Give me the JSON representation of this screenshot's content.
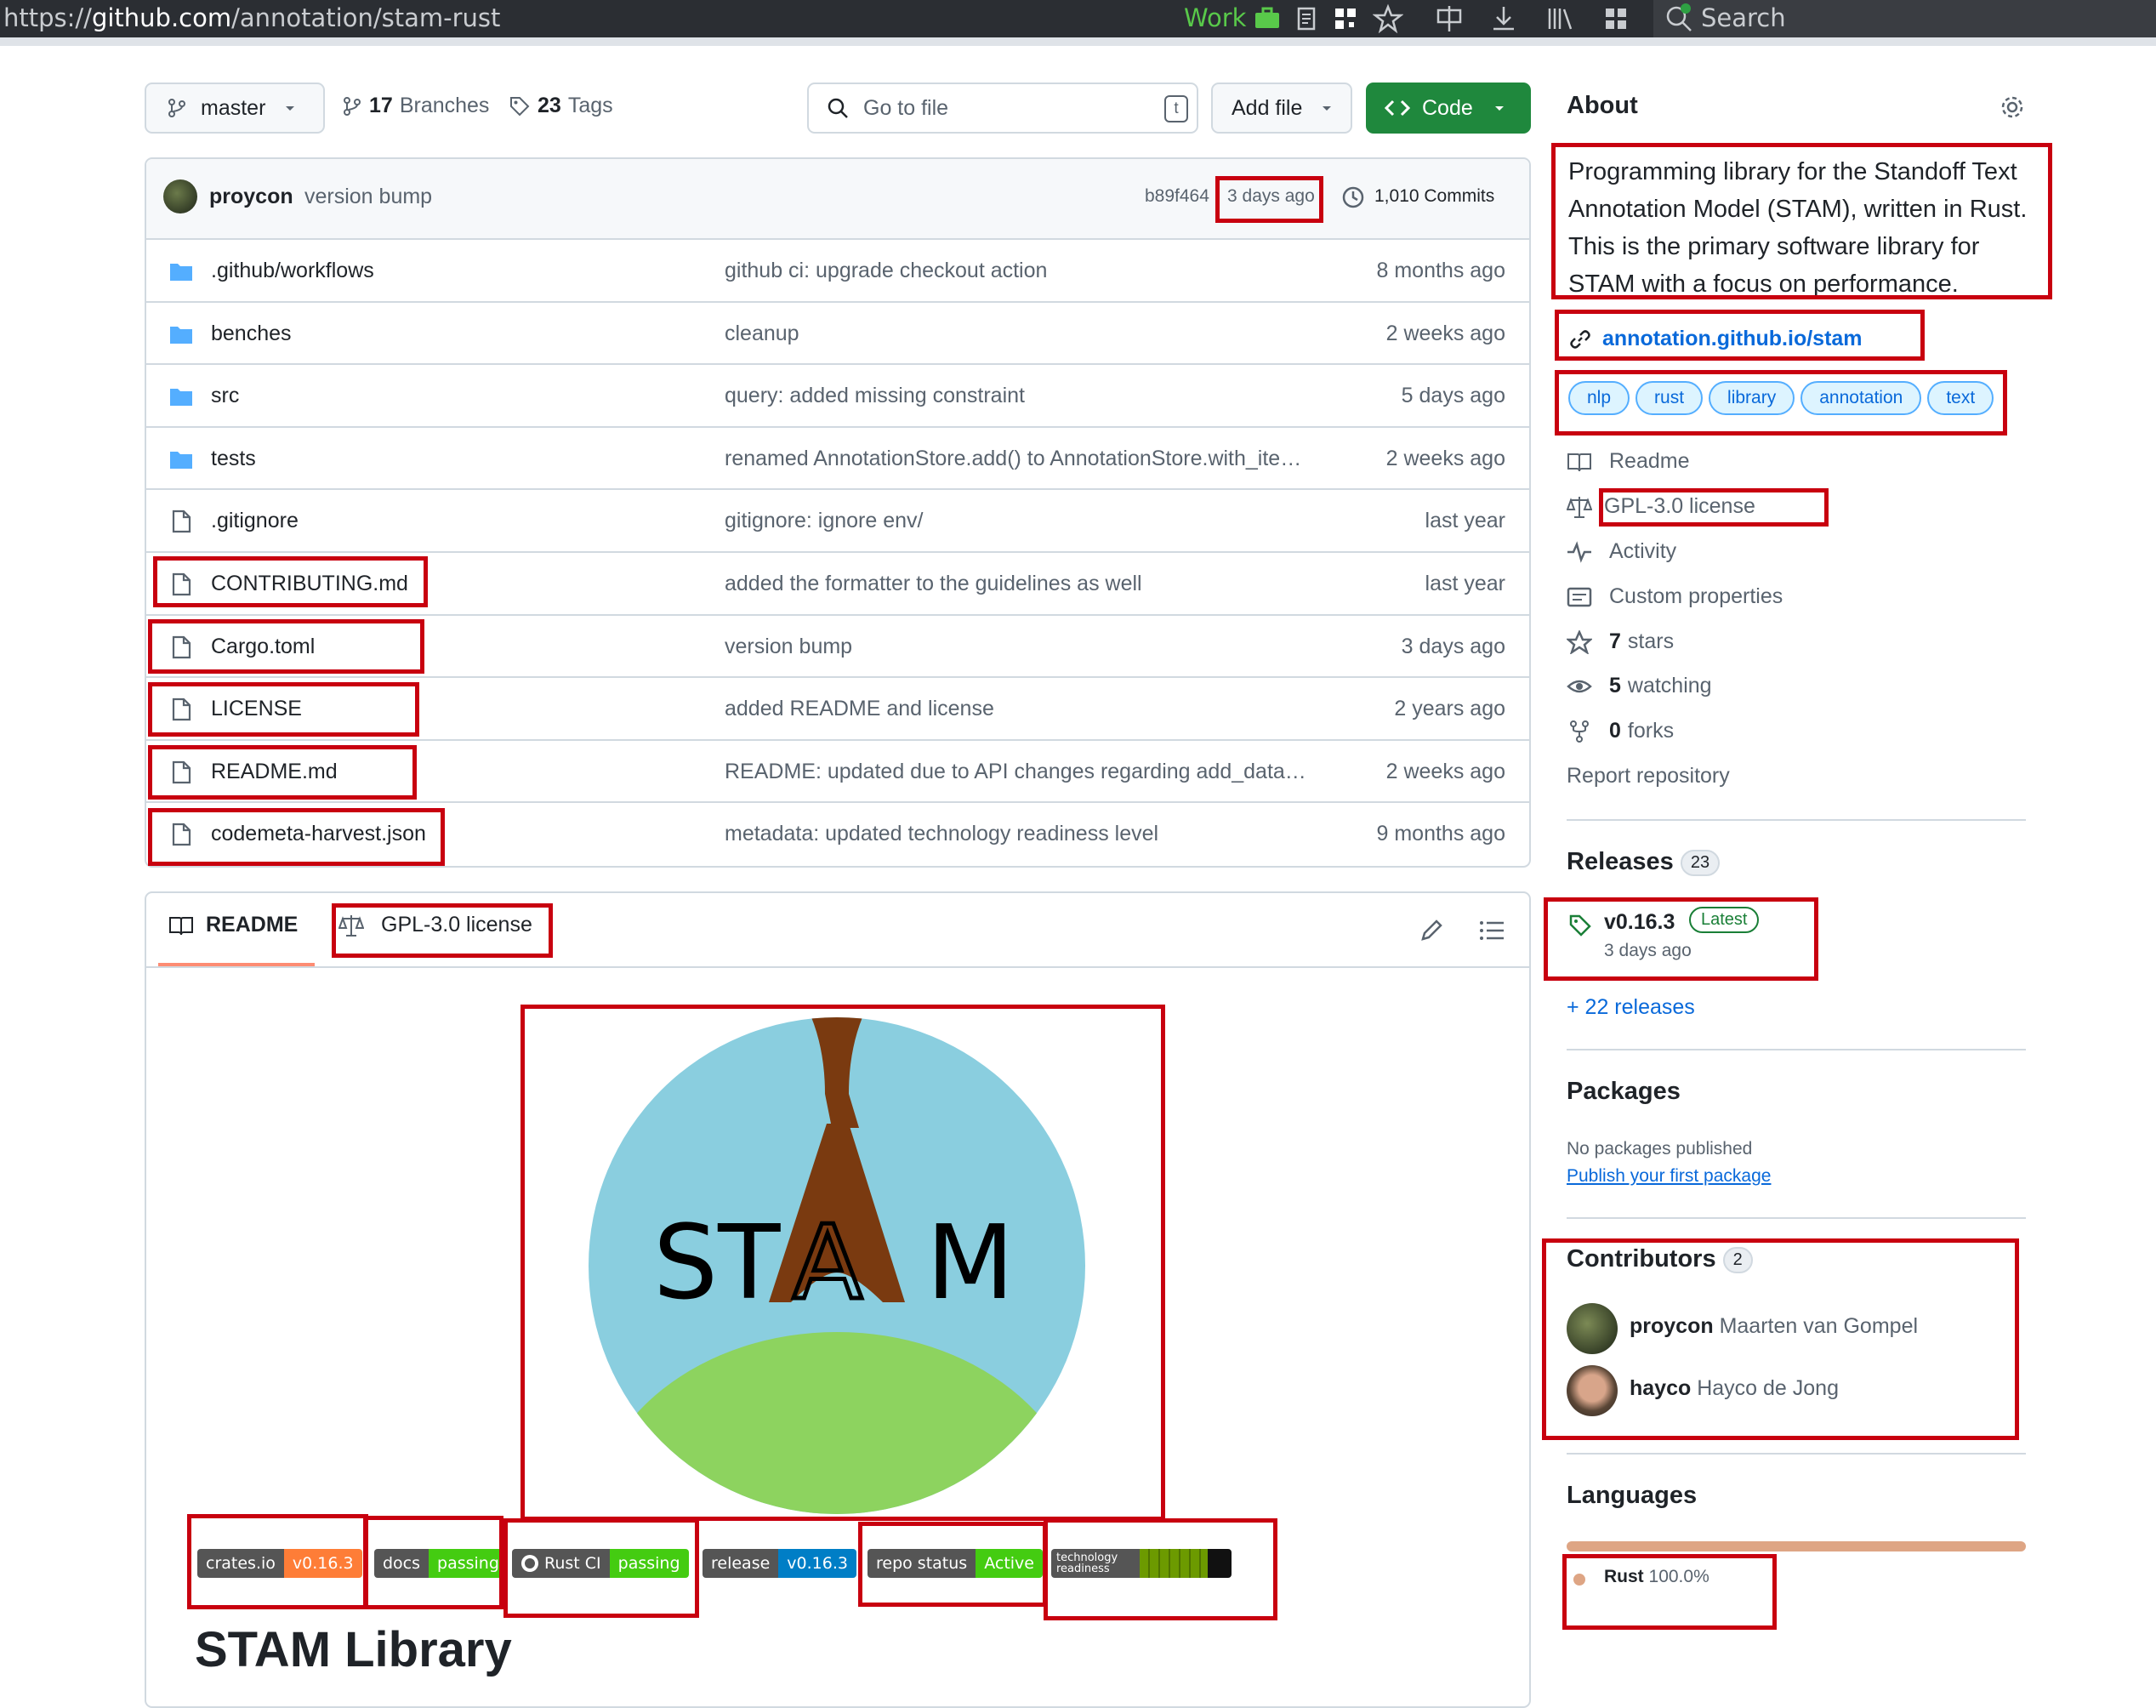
{
  "browser": {
    "url_prefix": "https://",
    "url_domain": "github.com",
    "url_path": "/annotation/stam-rust",
    "container_label": "Work",
    "search_placeholder": "Search"
  },
  "repo_toolbar": {
    "branch": "master",
    "branches_count": "17",
    "branches_label": "Branches",
    "tags_count": "23",
    "tags_label": "Tags",
    "goto_file_placeholder": "Go to file",
    "goto_file_shortcut": "t",
    "add_file_label": "Add file",
    "code_label": "Code"
  },
  "latest_commit": {
    "author": "proycon",
    "message": "version bump",
    "hash": "b89f464",
    "age": "3 days ago",
    "commits_label": "1,010 Commits"
  },
  "files": [
    {
      "type": "folder",
      "name": ".github/workflows",
      "message": "github ci: upgrade checkout action",
      "age": "8 months ago"
    },
    {
      "type": "folder",
      "name": "benches",
      "message": "cleanup",
      "age": "2 weeks ago"
    },
    {
      "type": "folder",
      "name": "src",
      "message": "query: added missing constraint",
      "age": "5 days ago"
    },
    {
      "type": "folder",
      "name": "tests",
      "message": "renamed AnnotationStore.add() to AnnotationStore.with_ite…",
      "age": "2 weeks ago"
    },
    {
      "type": "file",
      "name": ".gitignore",
      "message": "gitignore: ignore env/",
      "age": "last year"
    },
    {
      "type": "file",
      "name": "CONTRIBUTING.md",
      "message": "added the formatter to the guidelines as well",
      "age": "last year"
    },
    {
      "type": "file",
      "name": "Cargo.toml",
      "message": "version bump",
      "age": "3 days ago"
    },
    {
      "type": "file",
      "name": "LICENSE",
      "message": "added README and license",
      "age": "2 years ago"
    },
    {
      "type": "file",
      "name": "README.md",
      "message": "README: updated due to API changes regarding add_data…",
      "age": "2 weeks ago"
    },
    {
      "type": "file",
      "name": "codemeta-harvest.json",
      "message": "metadata: updated technology readiness level",
      "age": "9 months ago"
    }
  ],
  "readme_tabs": {
    "readme_label": "README",
    "license_label": "GPL-3.0 license"
  },
  "readme": {
    "logo_text_left": "ST",
    "logo_text_a": "A",
    "logo_text_right": "M",
    "badges": [
      {
        "left": "crates.io",
        "right": "v0.16.3",
        "color": "#fe7d37"
      },
      {
        "left": "docs",
        "right": "passing",
        "color": "#4c1"
      },
      {
        "left": "Rust CI",
        "right": "passing",
        "color": "#4c1"
      },
      {
        "left": "release",
        "right": "v0.16.3",
        "color": "#007ec6"
      },
      {
        "left": "repo status",
        "right": "Active",
        "color": "#4c1"
      },
      {
        "left": "technology readiness",
        "right": "",
        "color": "#6c9a00"
      }
    ],
    "heading": "STAM Library"
  },
  "about": {
    "title": "About",
    "description_lines": [
      "Programming library for the Standoff Text",
      "Annotation Model (STAM), written in Rust.",
      "This is the primary software library for",
      "STAM with a focus on performance."
    ],
    "website": "annotation.github.io/stam",
    "topics": [
      "nlp",
      "rust",
      "library",
      "annotation",
      "text"
    ],
    "readme_label": "Readme",
    "license_label": "GPL-3.0 license",
    "activity_label": "Activity",
    "custom_properties_label": "Custom properties",
    "stars_count": "7",
    "stars_label": "stars",
    "watching_count": "5",
    "watching_label": "watching",
    "forks_count": "0",
    "forks_label": "forks",
    "report_label": "Report repository"
  },
  "releases": {
    "title": "Releases",
    "count": "23",
    "latest_tag": "v0.16.3",
    "latest_badge": "Latest",
    "latest_age": "3 days ago",
    "more_label": "+ 22 releases"
  },
  "packages": {
    "title": "Packages",
    "empty_label": "No packages published",
    "publish_link": "Publish your first package"
  },
  "contributors": {
    "title": "Contributors",
    "count": "2",
    "people": [
      {
        "login": "proycon",
        "name": "Maarten van Gompel"
      },
      {
        "login": "hayco",
        "name": "Hayco de Jong"
      }
    ]
  },
  "languages": {
    "title": "Languages",
    "items": [
      {
        "name": "Rust",
        "percent": "100.0%",
        "color": "#dea584"
      }
    ]
  }
}
